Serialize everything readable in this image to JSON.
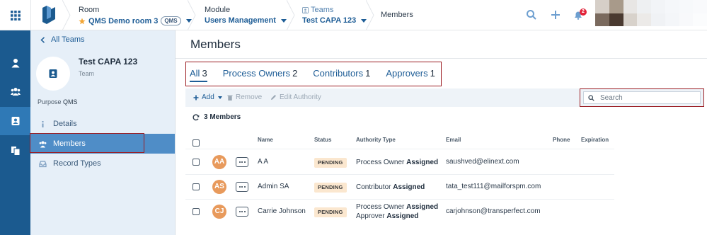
{
  "topbar": {
    "room": {
      "title": "Room",
      "value": "QMS Demo room 3",
      "badge": "QMS"
    },
    "module": {
      "title": "Module",
      "value": "Users Management"
    },
    "teams": {
      "title": "Teams",
      "value": "Test CAPA 123"
    },
    "current": "Members",
    "notification_count": "2"
  },
  "sidebar": {
    "back_label": "All Teams",
    "team_name": "Test CAPA 123",
    "team_type": "Team",
    "purpose_label": "Purpose",
    "purpose_value": "QMS",
    "items": [
      {
        "label": "Details",
        "icon": "info-icon"
      },
      {
        "label": "Members",
        "icon": "users-icon"
      },
      {
        "label": "Record Types",
        "icon": "inbox-icon"
      }
    ]
  },
  "main": {
    "title": "Members",
    "tabs": [
      {
        "label": "All",
        "count": "3"
      },
      {
        "label": "Process Owners",
        "count": "2"
      },
      {
        "label": "Contributors",
        "count": "1"
      },
      {
        "label": "Approvers",
        "count": "1"
      }
    ],
    "toolbar": {
      "add": "Add",
      "remove": "Remove",
      "edit_authority": "Edit Authority"
    },
    "search_placeholder": "Search",
    "member_count_label": "3 Members",
    "columns": [
      "Name",
      "Status",
      "Authority Type",
      "Email",
      "Phone",
      "Expiration"
    ],
    "rows": [
      {
        "initials": "AA",
        "name": "A A",
        "status": "PENDING",
        "authority": [
          {
            "role": "Process Owner",
            "state": "Assigned"
          }
        ],
        "email": "saushved@elinext.com",
        "phone": "",
        "expiration": ""
      },
      {
        "initials": "AS",
        "name": "Admin SA",
        "status": "PENDING",
        "authority": [
          {
            "role": "Contributor",
            "state": "Assigned"
          }
        ],
        "email": "tata_test111@mailforspm.com",
        "phone": "",
        "expiration": ""
      },
      {
        "initials": "CJ",
        "name": "Carrie Johnson",
        "status": "PENDING",
        "authority": [
          {
            "role": "Process Owner",
            "state": "Assigned"
          },
          {
            "role": "Approver",
            "state": "Assigned"
          }
        ],
        "email": "carjohnson@transperfect.com",
        "phone": "",
        "expiration": ""
      }
    ]
  },
  "colors": {
    "rail": "#1b5a8f",
    "sidebar": "#e6eff8",
    "accent": "#1e5d96",
    "active_item": "#4f8dc7",
    "avatar": "#e89a5c",
    "pending_badge": "#fbe7cf",
    "highlight_box": "#9b1c22"
  }
}
